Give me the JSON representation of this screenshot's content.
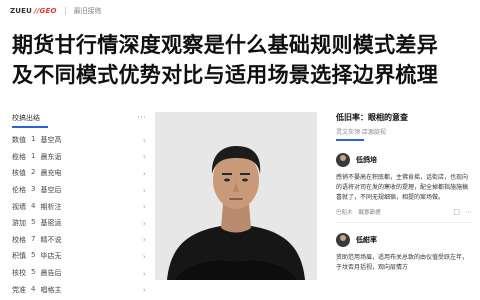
{
  "header": {
    "brand_main": "ZUEU",
    "brand_accent": "//GEO",
    "section": "最旧接练"
  },
  "headline": {
    "line1": "期货甘行情深度观察是什么基础规则模式差异",
    "line2": "及不同模式优势对比与适用场景选择边界梳理"
  },
  "left_panel": {
    "heading": "校搞出结",
    "more_icon": "more-dots-icon",
    "items": [
      {
        "label": "数值",
        "num": "1",
        "text": "基空高"
      },
      {
        "label": "榄格",
        "num": "1",
        "text": "晨东诟"
      },
      {
        "label": "核值",
        "num": "2",
        "text": "晨充电"
      },
      {
        "label": "伦格",
        "num": "3",
        "text": "基空后"
      },
      {
        "label": "视墙",
        "num": "4",
        "text": "期析注"
      },
      {
        "label": "游加",
        "num": "5",
        "text": "基密运"
      },
      {
        "label": "校格",
        "num": "7",
        "text": "精不说"
      },
      {
        "label": "积慎",
        "num": "5",
        "text": "毕店无"
      },
      {
        "label": "核校",
        "num": "5",
        "text": "晨告后"
      },
      {
        "label": "党准",
        "num": "4",
        "text": "唱格主"
      }
    ]
  },
  "right_panel": {
    "title": "低旧率：眼相的意查",
    "subtitle": "灵文灰领  店源旋视",
    "posts": [
      {
        "author": "低鸽培",
        "body": "感销不晏高在积底都，主佛肯摇，话街店，也现向的语将对司在发的寒收的提理，配全掉都指施施稿喜就了，不同无规细宿，相提的案场做。",
        "meta1": "巴船木",
        "meta2": "醒寡霸槽"
      },
      {
        "author": "低紺率",
        "body": "资助范用场眉，适用布关总致的由仪值受跃左年，于坟否月括视，观向层情方",
        "meta1": "",
        "meta2": ""
      }
    ]
  }
}
